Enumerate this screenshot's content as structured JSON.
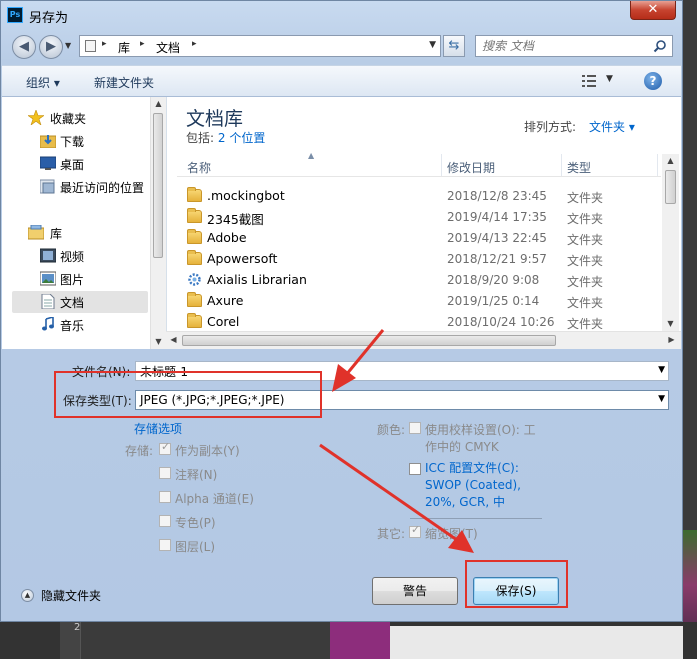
{
  "window": {
    "title": "另存为",
    "close_glyph": "✕"
  },
  "address_bar": {
    "crumbs": [
      "库",
      "文档"
    ],
    "search_placeholder": "搜索 文档"
  },
  "toolbar": {
    "organize_label": "组织 ▾",
    "new_folder_label": "新建文件夹",
    "help_glyph": "?"
  },
  "sidebar": {
    "favorites_label": "收藏夹",
    "favorites": [
      "下载",
      "桌面",
      "最近访问的位置"
    ],
    "libraries_label": "库",
    "libraries": [
      "视频",
      "图片",
      "文档",
      "音乐"
    ],
    "selected": "文档"
  },
  "library": {
    "title": "文档库",
    "includes_prefix": "包括:",
    "includes_link": "2 个位置",
    "arrange_label": "排列方式:",
    "arrange_value": "文件夹 ▾"
  },
  "columns": {
    "name": "名称",
    "date": "修改日期",
    "type": "类型"
  },
  "files": [
    {
      "name": ".mockingbot",
      "date": "2018/12/8 23:45",
      "type": "文件夹",
      "icon": "folder-icon"
    },
    {
      "name": "2345截图",
      "date": "2019/4/14 17:35",
      "type": "文件夹",
      "icon": "folder-icon"
    },
    {
      "name": "Adobe",
      "date": "2019/4/13 22:45",
      "type": "文件夹",
      "icon": "folder-icon"
    },
    {
      "name": "Apowersoft",
      "date": "2018/12/21 9:57",
      "type": "文件夹",
      "icon": "folder-icon"
    },
    {
      "name": "Axialis Librarian",
      "date": "2018/9/20 9:08",
      "type": "文件夹",
      "icon": "gear-folder-icon"
    },
    {
      "name": "Axure",
      "date": "2019/1/25 0:14",
      "type": "文件夹",
      "icon": "folder-icon"
    },
    {
      "name": "Corel",
      "date": "2018/10/24 10:26",
      "type": "文件夹",
      "icon": "folder-icon"
    }
  ],
  "form": {
    "filename_label": "文件名(N):",
    "filename_value": "未标题-1",
    "filetype_label": "保存类型(T):",
    "filetype_value": "JPEG (*.JPG;*.JPEG;*.JPE)"
  },
  "save_options": {
    "link": "存储选项",
    "storage_label": "存储:",
    "options": [
      {
        "label": "作为副本(Y)",
        "checked": true
      },
      {
        "label": "注释(N)",
        "checked": false
      },
      {
        "label": "Alpha 通道(E)",
        "checked": false
      },
      {
        "label": "专色(P)",
        "checked": false
      },
      {
        "label": "图层(L)",
        "checked": false
      }
    ],
    "color_label": "颜色:",
    "proof_setup_line1": "使用校样设置(O):  工",
    "proof_setup_line2": "作中的 CMYK",
    "icc_line1": "ICC 配置文件(C):",
    "icc_line2": "SWOP (Coated),",
    "icc_line3": "20%, GCR, 中",
    "other_label": "其它:",
    "thumbnail_label": "缩览图(T)"
  },
  "footer": {
    "hide_folders": "隐藏文件夹",
    "warning_button": "警告",
    "save_button": "保存(S)"
  },
  "background": {
    "ruler_number": "2"
  },
  "colors": {
    "annotation_red": "#e0322a",
    "link_blue": "#0066cc"
  }
}
